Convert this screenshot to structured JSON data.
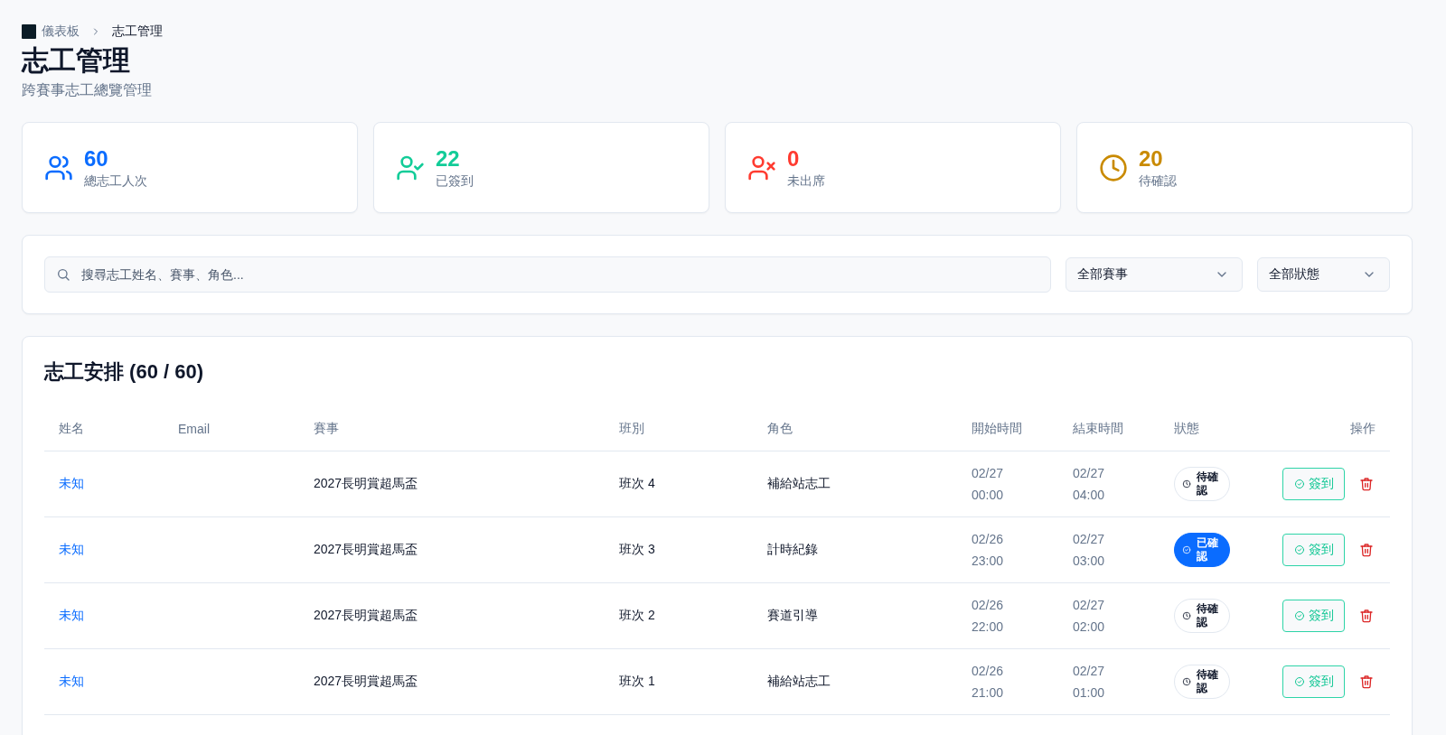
{
  "breadcrumb": [
    {
      "label": "儀表板",
      "current": false
    },
    {
      "label": "志工管理",
      "current": true
    }
  ],
  "page": {
    "title": "志工管理",
    "subtitle": "跨賽事志工總覽管理"
  },
  "stats": [
    {
      "kind": "users",
      "value": "60",
      "label": "總志工人次",
      "color": "#0a6cff"
    },
    {
      "kind": "checked",
      "value": "22",
      "label": "已簽到",
      "color": "#12cc98"
    },
    {
      "kind": "absent",
      "value": "0",
      "label": "未出席",
      "color": "#ff3b30"
    },
    {
      "kind": "pending",
      "value": "20",
      "label": "待確認",
      "color": "#c98a00"
    }
  ],
  "filters": {
    "search": {
      "placeholder": "搜尋志工姓名、賽事、角色..."
    },
    "selects": [
      "全部賽事",
      "全部狀態"
    ]
  },
  "table": {
    "title": "志工安排 (60 / 60)",
    "columns": [
      "姓名",
      "Email",
      "賽事",
      "班別",
      "角色",
      "開始時間",
      "結束時間",
      "狀態",
      "操作"
    ],
    "rows": [
      {
        "name": "未知",
        "event": "2027長明賞超馬盃",
        "shift": "班次 4",
        "role": "補給站志工",
        "start": "02/27 00:00",
        "end": "02/27 04:00",
        "status": {
          "kind": "pending",
          "label": "待確認"
        },
        "action": "簽到"
      },
      {
        "name": "未知",
        "event": "2027長明賞超馬盃",
        "shift": "班次 3",
        "role": "計時紀錄",
        "start": "02/26 23:00",
        "end": "02/27 03:00",
        "status": {
          "kind": "confirmed",
          "label": "已確認"
        },
        "action": "簽到"
      },
      {
        "name": "未知",
        "event": "2027長明賞超馬盃",
        "shift": "班次 2",
        "role": "賽道引導",
        "start": "02/26 22:00",
        "end": "02/27 02:00",
        "status": {
          "kind": "pending",
          "label": "待確認"
        },
        "action": "簽到"
      },
      {
        "name": "未知",
        "event": "2027長明賞超馬盃",
        "shift": "班次 1",
        "role": "補給站志工",
        "start": "02/26 21:00",
        "end": "02/27 01:00",
        "status": {
          "kind": "pending",
          "label": "待確認"
        },
        "action": "簽到"
      }
    ]
  }
}
